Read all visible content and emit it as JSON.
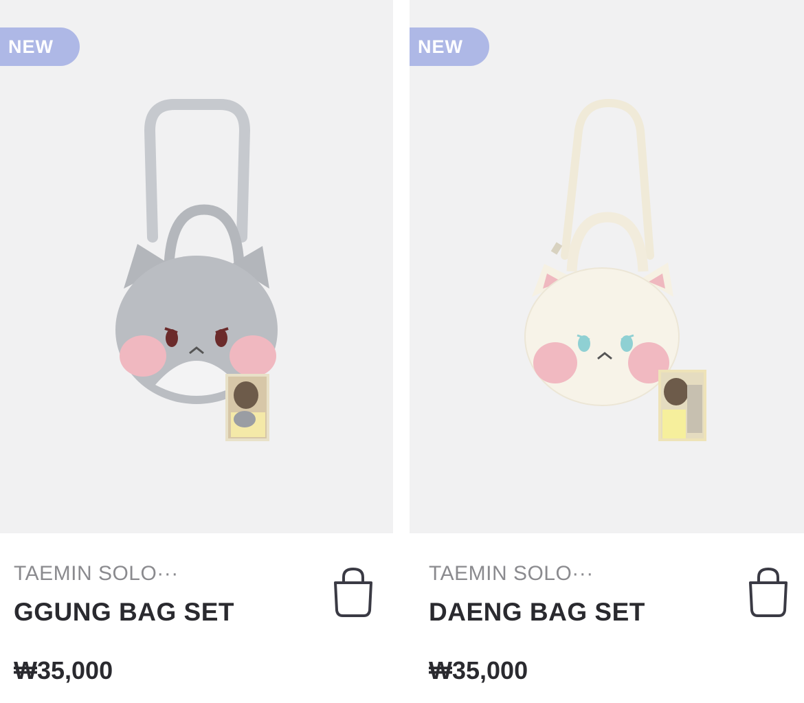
{
  "products": [
    {
      "badge": "NEW",
      "artist": "TAEMIN SOLO···",
      "name": "GGUNG BAG SET",
      "price": "₩35,000",
      "image_desc_icon": "gray-cat-bag-image",
      "colors": {
        "bag": "#b9bcc1",
        "cheek": "#f2b9c0",
        "strap": "#c3c6cb"
      }
    },
    {
      "badge": "NEW",
      "artist": "TAEMIN SOLO···",
      "name": "DAENG BAG SET",
      "price": "₩35,000",
      "image_desc_icon": "cream-cat-bag-image",
      "colors": {
        "bag": "#f6f2e6",
        "cheek": "#f2b9c0",
        "strap": "#efe9d6"
      }
    }
  ],
  "cart_icon": "shopping-bag-icon"
}
